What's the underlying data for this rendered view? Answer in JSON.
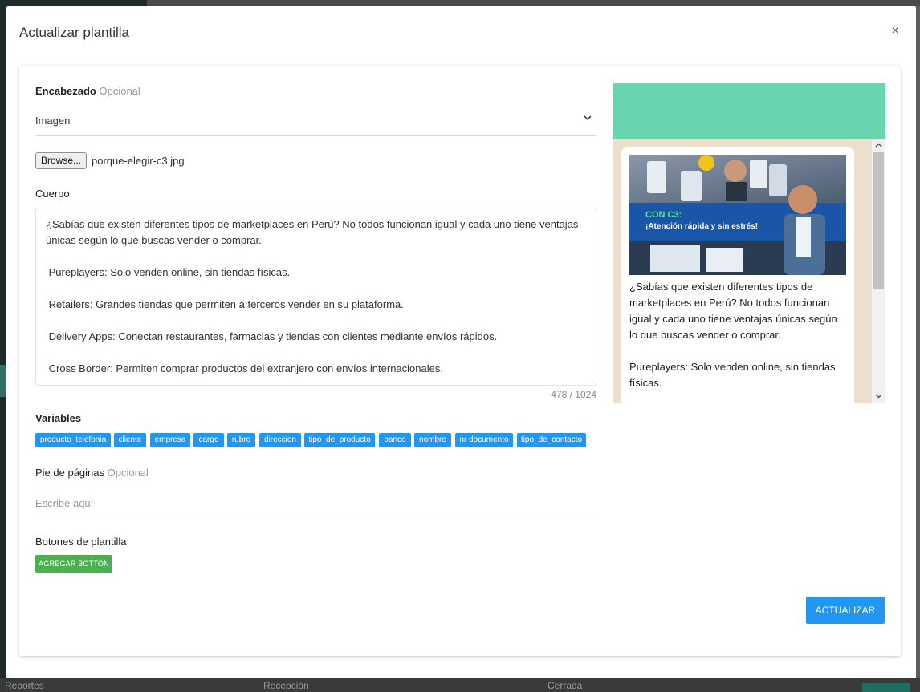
{
  "modal": {
    "title": "Actualizar plantilla",
    "close_icon": "×"
  },
  "header_section": {
    "label": "Encabezado",
    "optional": "Opcional",
    "select_value": "Imagen"
  },
  "file": {
    "browse_label": "Browse...",
    "filename": "porque-elegir-c3.jpg"
  },
  "body_section": {
    "label": "Cuerpo",
    "text": "¿Sabías que existen diferentes tipos de marketplaces en Perú? No todos funcionan igual y cada uno tiene ventajas únicas según lo que buscas vender o comprar.\n\n Pureplayers: Solo venden online, sin tiendas físicas.\n\n Retailers: Grandes tiendas que permiten a terceros vender en su plataforma.\n\n Delivery Apps: Conectan restaurantes, farmacias y tiendas con clientes mediante envíos rápidos.\n\n Cross Border: Permiten comprar productos del extranjero con envíos internacionales.",
    "counter": "478 / 1024"
  },
  "variables": {
    "label": "Variables",
    "items": [
      "producto_telefonia",
      "cliente",
      "empresa",
      "cargo",
      "rubro",
      "direccion",
      "tipo_de_producto",
      "banco",
      "nombre",
      "nr documento",
      "tipo_de_contacto"
    ]
  },
  "footer_section": {
    "label": "Pie de páginas",
    "optional": "Opcional",
    "placeholder": "Escribe aquí"
  },
  "buttons_section": {
    "label": "Botones de plantilla",
    "add_label": "AGREGAR BOTTON"
  },
  "actions": {
    "update_label": "ACTUALIZAR"
  },
  "preview": {
    "image_text_1": "CON C3:",
    "image_text_2": "¡Atención rápida y sin estrés!",
    "text": "¿Sabías que existen diferentes tipos de marketplaces en Perú? No todos funcionan igual y cada uno tiene ventajas únicas según lo que buscas vender o comprar.\n\nPureplayers: Solo venden online, sin tiendas físicas."
  },
  "background": {
    "bottom_left": "Reportes",
    "bottom_mid_1": "Recepción",
    "bottom_mid_2": "Cerrada"
  },
  "colors": {
    "primary": "#2196f3",
    "success": "#4caf50",
    "preview_header": "#68d5ae",
    "preview_body": "#ece0cd"
  }
}
